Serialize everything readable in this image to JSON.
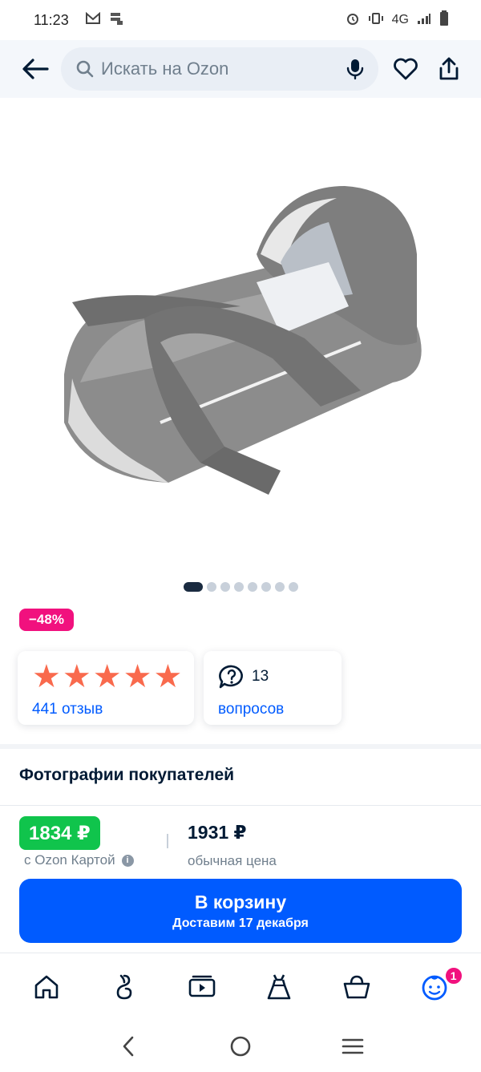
{
  "status_bar": {
    "time": "11:23",
    "network": "4G"
  },
  "header": {
    "search_placeholder": "Искать на Ozon"
  },
  "product": {
    "image_alt": "gray baby carrycot",
    "carousel": {
      "count": 8,
      "active": 0
    },
    "discount": "−48%"
  },
  "rating": {
    "stars": 5,
    "reviews_label": "441 отзыв"
  },
  "questions": {
    "count": "13",
    "label": "вопросов"
  },
  "photos_title": "Фотографии покупателей",
  "price": {
    "ozon_price": "1834 ₽",
    "ozon_card_label": "с Ozon Картой",
    "regular_price": "1931 ₽",
    "regular_label": "обычная цена"
  },
  "cart_button": {
    "label": "В корзину",
    "delivery": "Доставим 17 декабря"
  },
  "bottom_nav": {
    "items": [
      {
        "name": "home-icon"
      },
      {
        "name": "fresh-icon"
      },
      {
        "name": "video-icon"
      },
      {
        "name": "dress-icon"
      },
      {
        "name": "basket-icon"
      },
      {
        "name": "profile-icon",
        "badge": "1"
      }
    ]
  },
  "colors": {
    "accent": "#005bff",
    "discount": "#f1117e",
    "ozon_price_bg": "#10c44c",
    "star": "#f96a4d"
  }
}
